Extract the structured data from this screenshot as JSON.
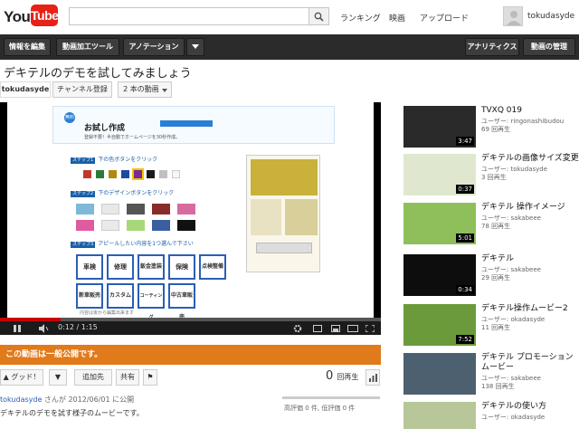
{
  "header": {
    "logo_you": "You",
    "logo_tube": "Tube",
    "search_placeholder": "",
    "links": [
      "ランキング",
      "映画",
      "アップロード"
    ],
    "username": "tokudasyde"
  },
  "toolbar": {
    "left": [
      "情報を編集",
      "動画加工ツール",
      "アノテーション"
    ],
    "right": [
      "アナリティクス",
      "動画の管理"
    ]
  },
  "video": {
    "title": "デキテルのデモを試してみましょう",
    "channel": "tokudasyde",
    "subscribe": "チャンネル登録",
    "video_count": "2 本の動画",
    "time": "0:12 / 1:15",
    "progress": 0.16
  },
  "demo": {
    "badge": "無料",
    "title": "お試し作成",
    "subtitle": "登録不要！半自動でホームページを30秒作成。",
    "step1": "下の色ボタンをクリック",
    "step2": "下のデザインボタンをクリック",
    "step3": "アピールしたい内容を1つ選んで下さい",
    "step_tag1": "ステップ1",
    "step_tag2": "ステップ2",
    "step_tag3": "ステップ3",
    "swatch_colors": [
      "#c0392b",
      "#2c7a3a",
      "#b08a10",
      "#1f4aa0",
      "#7a2b95",
      "#1a1a1a",
      "#c0c0c0",
      "#f7f7f7"
    ],
    "options": [
      "車検",
      "修理",
      "鈑金塗装",
      "保険",
      "点検整備",
      "新車販売",
      "カスタム",
      "コーティング",
      "中古車販売"
    ],
    "footer": "内容は後から編集出来ます"
  },
  "public_notice": "この動画は一般公開です。",
  "actions": {
    "like": "グッド！",
    "add": "追加先",
    "share": "共有"
  },
  "views": {
    "count": "0",
    "unit": "回再生"
  },
  "likes_text": "高評価 0 件, 低評価 0 件",
  "uploader": {
    "name": "tokudasyde",
    "text": " さんが 2012/06/01 に公開"
  },
  "description": "デキテルのデモを試す様子のムービーです。",
  "related": [
    {
      "title": "TVXQ 019",
      "user": "ユーザー: ringonashibudou",
      "views": "69 回再生",
      "duration": "3:47"
    },
    {
      "title": "デキテルの画像サイズ変更",
      "user": "ユーザー: tokudasyde",
      "views": "3 回再生",
      "duration": "0:37"
    },
    {
      "title": "デキテル 操作イメージ",
      "user": "ユーザー: sakabeee",
      "views": "78 回再生",
      "duration": "5:01"
    },
    {
      "title": "デキテル",
      "user": "ユーザー: sakabeee",
      "views": "29 回再生",
      "duration": "0:34"
    },
    {
      "title": "デキテル操作ムービー2",
      "user": "ユーザー: okadasyde",
      "views": "11 回再生",
      "duration": "7:52"
    },
    {
      "title": "デキテル プロモーションムービー",
      "user": "ユーザー: sakabeee",
      "views": "138 回再生",
      "duration": ""
    },
    {
      "title": "デキテルの使い方",
      "user": "ユーザー: okadasyde",
      "views": "",
      "duration": ""
    }
  ]
}
